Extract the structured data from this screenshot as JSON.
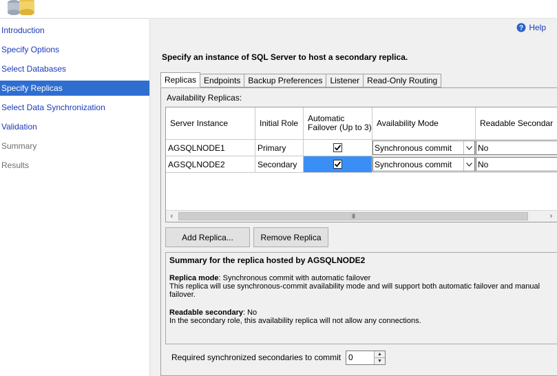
{
  "sidebar": {
    "items": [
      {
        "label": "Introduction",
        "state": "link"
      },
      {
        "label": "Specify Options",
        "state": "link"
      },
      {
        "label": "Select Databases",
        "state": "link"
      },
      {
        "label": "Specify Replicas",
        "state": "active"
      },
      {
        "label": "Select Data Synchronization",
        "state": "link"
      },
      {
        "label": "Validation",
        "state": "link"
      },
      {
        "label": "Summary",
        "state": "disabled"
      },
      {
        "label": "Results",
        "state": "disabled"
      }
    ]
  },
  "header": {
    "help_label": "Help",
    "instruction": "Specify an instance of SQL Server to host a secondary replica."
  },
  "tabs": [
    "Replicas",
    "Endpoints",
    "Backup Preferences",
    "Listener",
    "Read-Only Routing"
  ],
  "replicas_panel": {
    "label": "Availability Replicas:",
    "columns": [
      "Server Instance",
      "Initial Role",
      "Automatic Failover (Up to 3)",
      "Availability Mode",
      "Readable Secondar"
    ],
    "rows": [
      {
        "server": "AGSQLNODE1",
        "role": "Primary",
        "auto_failover": true,
        "mode": "Synchronous commit",
        "readable": "No"
      },
      {
        "server": "AGSQLNODE2",
        "role": "Secondary",
        "auto_failover": true,
        "mode": "Synchronous commit",
        "readable": "No"
      }
    ],
    "scroll_thumb": "III"
  },
  "buttons": {
    "add_replica": "Add Replica...",
    "remove_replica": "Remove Replica"
  },
  "summary": {
    "title": "Summary for the replica hosted by AGSQLNODE2",
    "mode_key": "Replica mode",
    "mode_value": ": Synchronous commit with automatic failover",
    "mode_desc": "This replica will use synchronous-commit availability mode and will support both automatic failover and manual failover.",
    "readable_key": "Readable secondary",
    "readable_value": ": No",
    "readable_desc": "In the secondary role, this availability replica will not allow any connections."
  },
  "bottom": {
    "required_label": "Required synchronized secondaries to commit",
    "required_value": "0"
  },
  "colors": {
    "link": "#1a3ab8",
    "selection": "#2f6ed0",
    "cell_highlight": "#3a8ff6"
  }
}
